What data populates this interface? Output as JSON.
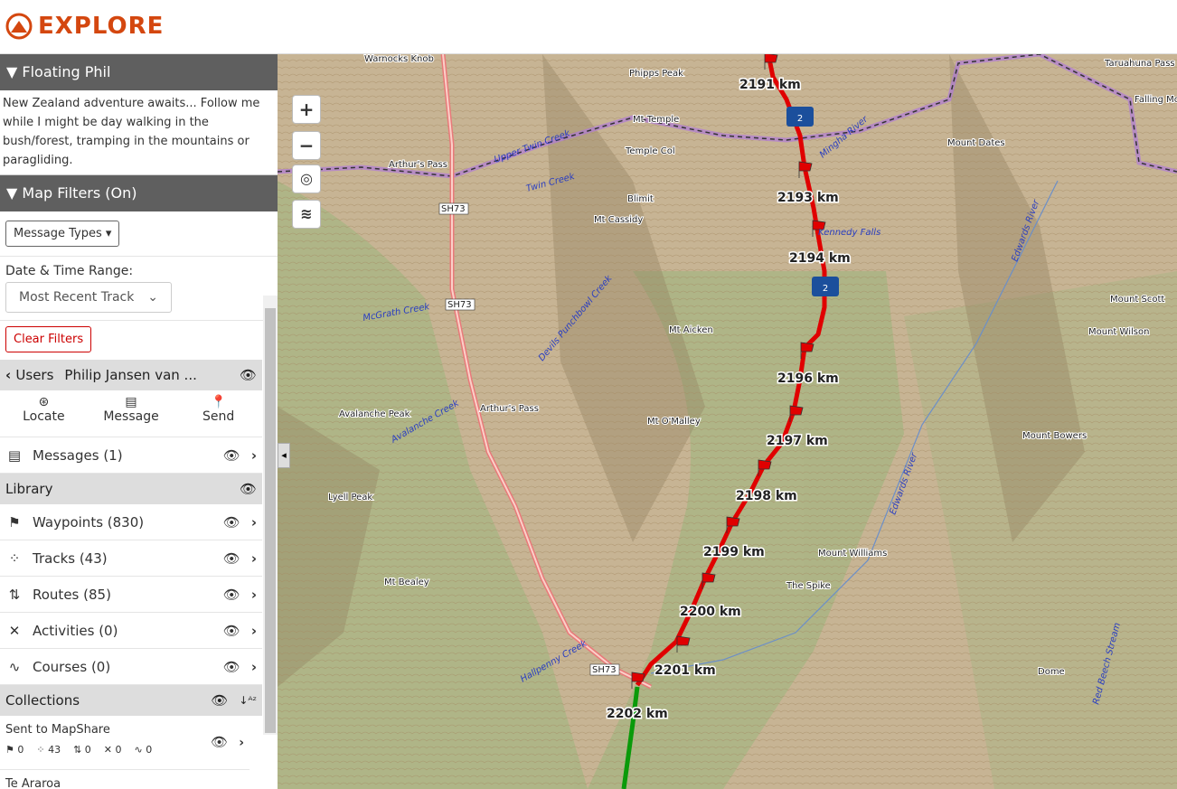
{
  "app": {
    "title": "EXPLORE",
    "brand_color": "#d4470f"
  },
  "profile": {
    "header": "▼ Floating Phil",
    "description": "New Zealand adventure awaits... Follow me while I might be day walking in the bush/forest, tramping in the mountains or paragliding."
  },
  "filters": {
    "header": "▼ Map Filters (On)",
    "message_types": "Message Types",
    "date_label": "Date & Time Range:",
    "date_value": "Most Recent Track",
    "clear": "Clear Filters"
  },
  "users": {
    "back": "Users",
    "name": "Philip Jansen van ...",
    "actions": [
      {
        "label": "Locate",
        "icon": "locate-icon"
      },
      {
        "label": "Message",
        "icon": "message-icon"
      },
      {
        "label": "Send",
        "icon": "pin-icon"
      }
    ],
    "messages": "Messages (1)"
  },
  "library": {
    "title": "Library",
    "items": [
      {
        "label": "Waypoints (830)",
        "icon": "flag-icon"
      },
      {
        "label": "Tracks (43)",
        "icon": "footprints-icon"
      },
      {
        "label": "Routes (85)",
        "icon": "route-icon"
      },
      {
        "label": "Activities (0)",
        "icon": "person-icon"
      },
      {
        "label": "Courses (0)",
        "icon": "course-icon"
      }
    ]
  },
  "collections": {
    "title": "Collections",
    "items": [
      {
        "name": "Sent to MapShare",
        "counts": [
          "0",
          "43",
          "0",
          "0",
          "0"
        ]
      },
      {
        "name": "Te Araroa"
      }
    ]
  },
  "map": {
    "controls": {
      "zoom_in": "+",
      "zoom_out": "−"
    },
    "track_color": "#e00000",
    "km_labels": [
      "2191 km",
      "2193 km",
      "2194 km",
      "2196 km",
      "2197 km",
      "2198 km",
      "2199 km",
      "2200 km",
      "2201 km",
      "2202 km"
    ],
    "places": [
      "Warnocks Knob",
      "Phipps Peak",
      "Mt Temple",
      "Temple Col",
      "Blimit",
      "Mt Cassidy",
      "Mt Aicken",
      "Arthur's Pass",
      "Avalanche Peak",
      "Mt O'Malley",
      "Lyell Peak",
      "Mt Bealey",
      "Mount Williams",
      "The Spike",
      "Dome",
      "Mount Dates",
      "Mount Scott",
      "Mount Wilson",
      "Mount Bowers",
      "Falling Mountain",
      "Taruahuna Pass",
      "Arthur's Pass"
    ],
    "rivers": [
      "Upper Twin Creek",
      "Twin Creek",
      "McGrath Creek",
      "Devils Punchbowl Creek",
      "Avalanche Creek",
      "Edwards River",
      "Mingha River",
      "Kennedy Falls",
      "Hallpenny Creek",
      "Red Beech Stream",
      "Edwards River"
    ],
    "roads": [
      "SH73",
      "SH73",
      "SH73"
    ],
    "cluster_count": "2"
  }
}
